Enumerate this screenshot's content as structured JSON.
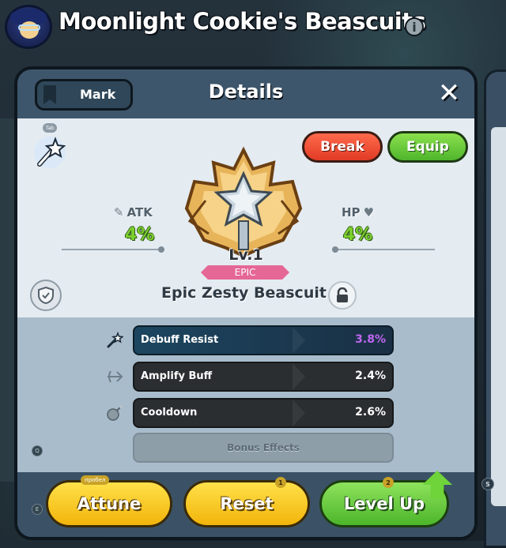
{
  "header": {
    "title": "Moonlight Cookie's Beascuits"
  },
  "dialog": {
    "mark_label": "Mark",
    "title": "Details",
    "tab_chip": "Tab",
    "break_label": "Break",
    "equip_label": "Equip",
    "atk_label": "ATK",
    "atk_value": "4%",
    "hp_label": "HP",
    "hp_value": "4%",
    "level": "Lv.1",
    "rarity": "EPIC",
    "item_name": "Epic Zesty Beascuit",
    "substats": [
      {
        "name": "Debuff Resist",
        "value": "3.8%"
      },
      {
        "name": "Amplify Buff",
        "value": "2.4%"
      },
      {
        "name": "Cooldown",
        "value": "2.6%"
      }
    ],
    "bonus_label": "Bonus Effects",
    "key_hints": {
      "q": "Q",
      "e": "E",
      "s": "S"
    },
    "buttons": {
      "attune": "Attune",
      "attune_chip": "пробел",
      "reset": "Reset",
      "reset_count": "1",
      "levelup": "Level Up",
      "levelup_count": "2"
    }
  },
  "colors": {
    "atk_hp_value": "#7ccf2e",
    "debuff_value": "#c067f2",
    "break": "#e9482f",
    "equip": "#6ccb3a",
    "yellow_button": "#f7c91d",
    "green_button": "#6ccb3a"
  }
}
